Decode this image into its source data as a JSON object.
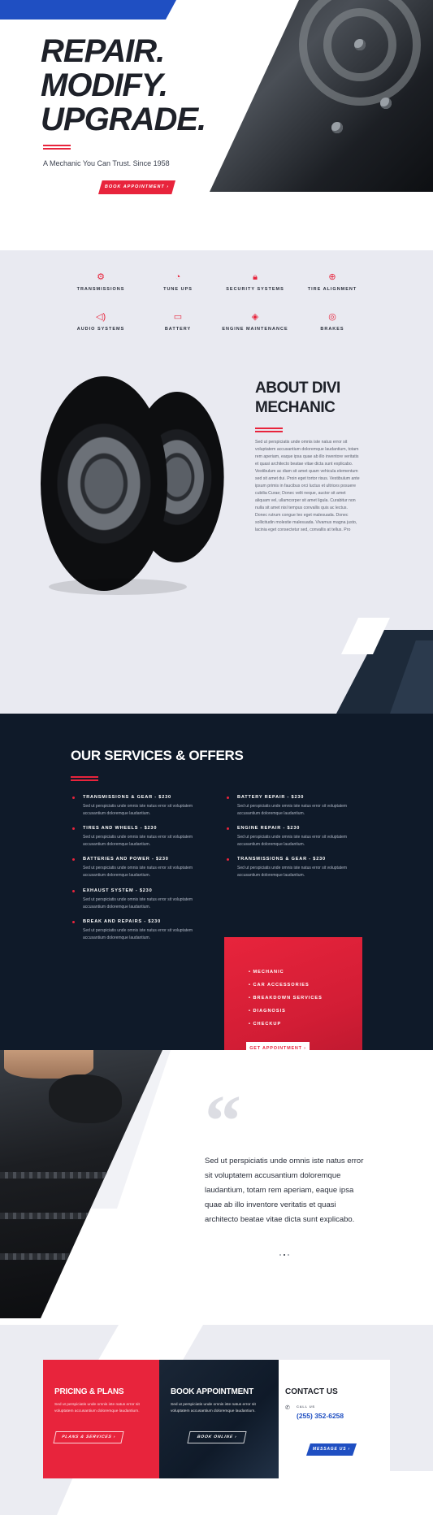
{
  "hero": {
    "title_lines": [
      "REPAIR.",
      "MODIFY.",
      "UPGRADE."
    ],
    "tagline": "A Mechanic You Can Trust. Since 1958",
    "cta_label": "BOOK APPOINTMENT ›"
  },
  "services": {
    "items": [
      {
        "label": "TRANSMISSIONS",
        "icon": "transmission-icon"
      },
      {
        "label": "TUNE UPS",
        "icon": "gauge-icon"
      },
      {
        "label": "SECURITY SYSTEMS",
        "icon": "lock-icon"
      },
      {
        "label": "TIRE ALIGNMENT",
        "icon": "steering-wheel-icon"
      },
      {
        "label": "AUDIO SYSTEMS",
        "icon": "speaker-icon"
      },
      {
        "label": "BATTERY",
        "icon": "battery-icon"
      },
      {
        "label": "ENGINE MAINTENANCE",
        "icon": "engine-icon"
      },
      {
        "label": "BRAKES",
        "icon": "brake-icon"
      }
    ]
  },
  "about": {
    "title_lines": [
      "ABOUT DIVI",
      "MECHANIC"
    ],
    "body": "Sed ut perspiciatis unde omnis iste natus error sit voluptatem accusantium doloremque laudantium, totam rem aperiam, eaque ipsa quae ab illo inventore veritatis et quasi architecto beatae vitae dicta sunt explicabo. Vestibulum ac diam sit amet quam vehicula elementum sed sit amet dui. Proin eget tortor risus. Vestibulum ante ipsum primis in faucibus orci luctus et ultrices posuere cubilia Curae; Donec velit neque, auctor sit amet aliquam vel, ullamcorper sit amet ligula. Curabitur non nulla sit amet nisl tempus convallis quis ac lectus. Donec rutrum congue leo eget malesuada. Donec sollicitudin molestie malesuada. Vivamus magna justo, lacinia eget consectetur sed, convallis at tellus. Pro"
  },
  "offers": {
    "title": "OUR SERVICES & OFFERS",
    "left": [
      {
        "title": "TRANSMISSIONS & GEAR - $230",
        "desc": "Sed ut perspiciatis unde omnis iste natus error sit voluptatem accusantium doloremque laudantium."
      },
      {
        "title": "TIRES AND WHEELS - $230",
        "desc": "Sed ut perspiciatis unde omnis iste natus error sit voluptatem accusantium doloremque laudantium."
      },
      {
        "title": "BATTERIES AND POWER - $230",
        "desc": "Sed ut perspiciatis unde omnis iste natus error sit voluptatem accusantium doloremque laudantium."
      },
      {
        "title": "EXHAUST SYSTEM - $230",
        "desc": "Sed ut perspiciatis unde omnis iste natus error sit voluptatem accusantium doloremque laudantium."
      },
      {
        "title": "BREAK AND REPAIRS - $230",
        "desc": "Sed ut perspiciatis unde omnis iste natus error sit voluptatem accusantium doloremque laudantium."
      }
    ],
    "right": [
      {
        "title": "BATTERY REPAIR - $230",
        "desc": "Sed ut perspiciatis unde omnis iste natus error sit voluptatem accusantium doloremque laudantium."
      },
      {
        "title": "ENGINE REPAIR - $230",
        "desc": "Sed ut perspiciatis unde omnis iste natus error sit voluptatem accusantium doloremque laudantium."
      },
      {
        "title": "TRANSMISSIONS & GEAR - $230",
        "desc": "Sed ut perspiciatis unde omnis iste natus error sit voluptatem accusantium doloremque laudantium."
      }
    ],
    "card_list": [
      "MECHANIC",
      "CAR ACCESSORIES",
      "BREAKDOWN SERVICES",
      "DIAGNOSIS",
      "CHECKUP"
    ],
    "card_cta": "GET APPOINTMENT ›"
  },
  "testimonial": {
    "quote": "Sed ut perspiciatis unde omnis iste natus error sit voluptatem accusantium doloremque laudantium, totam rem aperiam, eaque ipsa quae ab illo inventore veritatis et quasi architecto beatae vitae dicta sunt explicabo."
  },
  "bottom": {
    "pricing": {
      "title": "PRICING & PLANS",
      "desc": "Sed ut perspiciatis unde omnis iste natus error sit voluptatem accusantium doloremque laudantium.",
      "cta": "PLANS & SERVICES ›"
    },
    "booking": {
      "title": "BOOK APPOINTMENT",
      "desc": "Sed ut perspiciatis unde omnis iste natus error sit voluptatem accusantium doloremque laudantium.",
      "cta": "BOOK ONLINE ›"
    },
    "contact": {
      "title": "CONTACT US",
      "call_label": "CALL US",
      "phone": "(255) 352-6258",
      "cta": "MESSAGE US ›"
    }
  },
  "colors": {
    "accent": "#e8243c",
    "brand_blue": "#1f4fc2",
    "dark": "#0f1a29"
  }
}
